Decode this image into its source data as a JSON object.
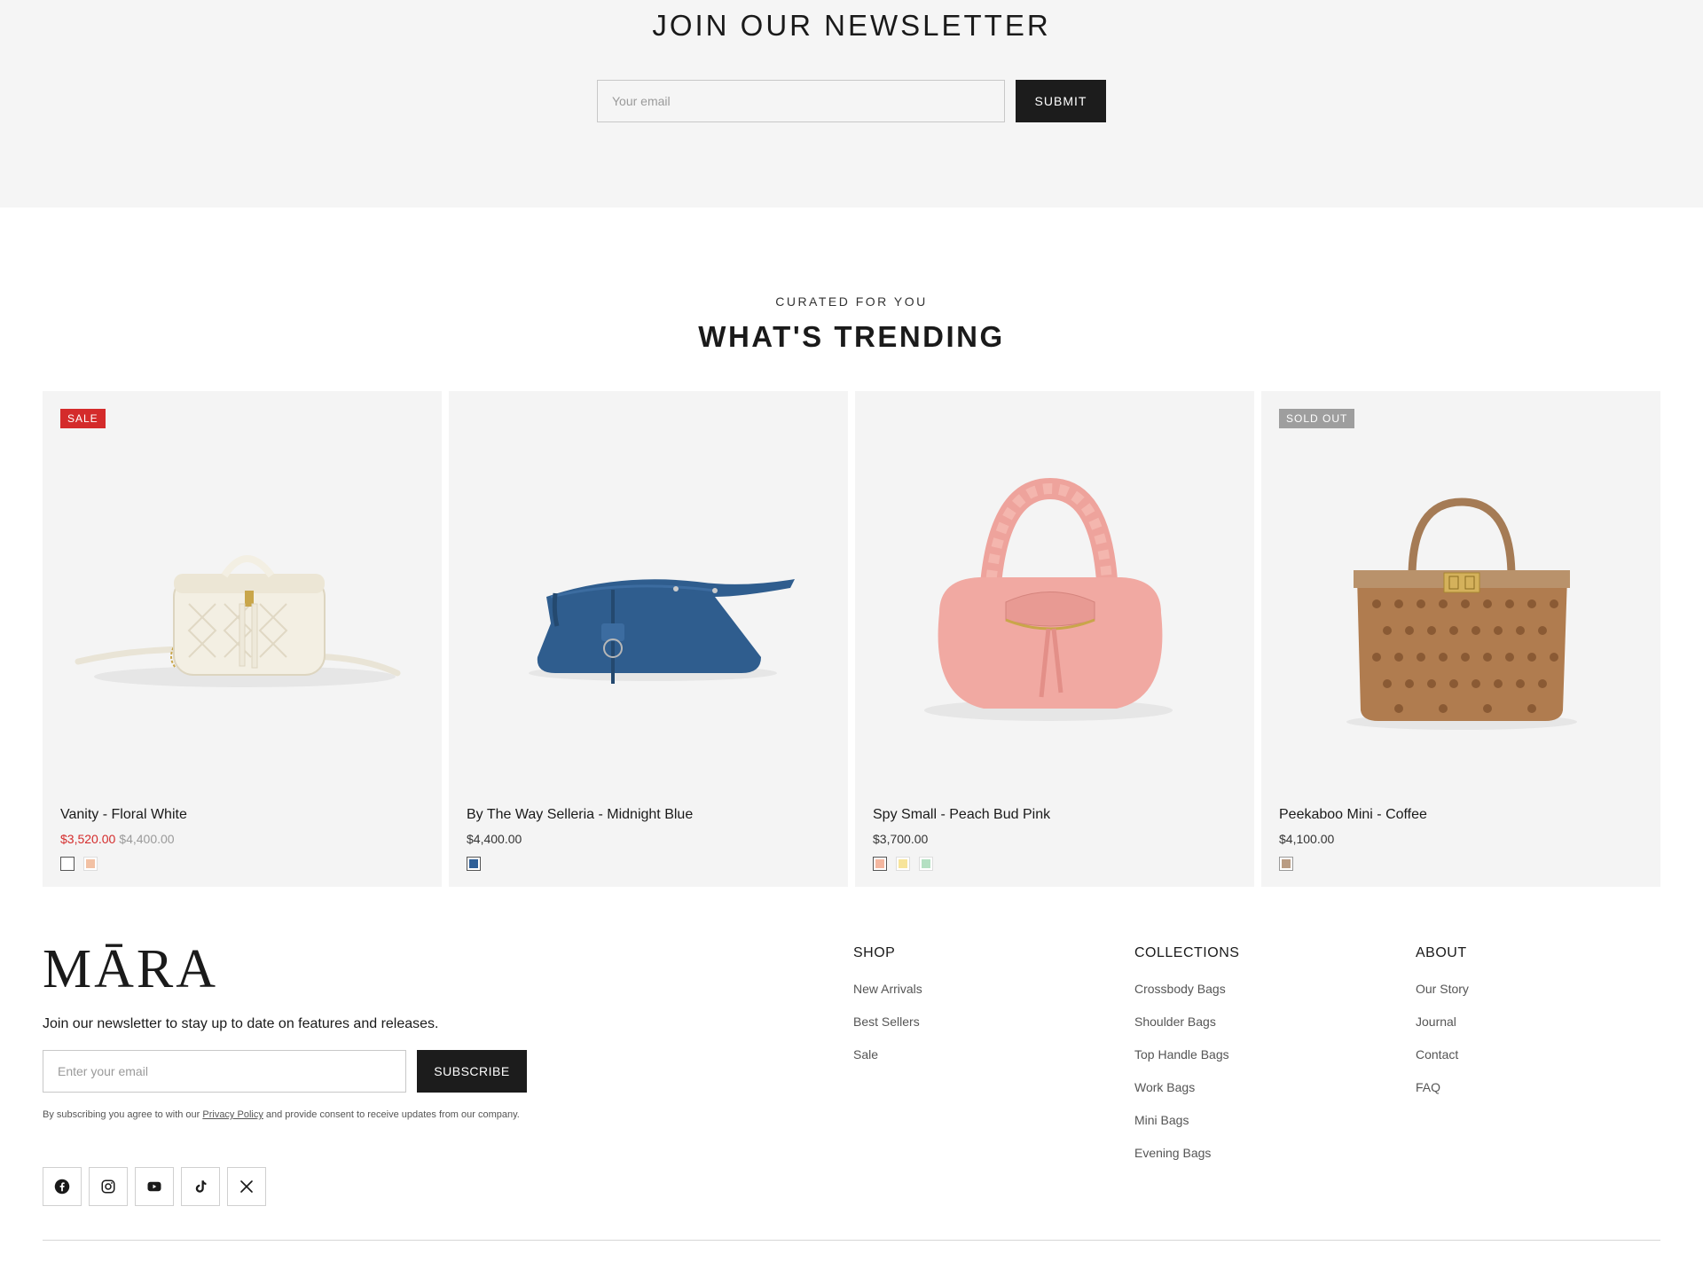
{
  "newsletter": {
    "title": "JOIN OUR NEWSLETTER",
    "placeholder": "Your email",
    "submit_label": "SUBMIT"
  },
  "trending": {
    "eyebrow": "CURATED FOR YOU",
    "title": "WHAT'S TRENDING",
    "products": [
      {
        "badge": "SALE",
        "name": "Vanity - Floral White",
        "sale_price": "$3,520.00",
        "original_price": "$4,400.00",
        "swatches": [
          "#ffffff",
          "#f2c1a4"
        ]
      },
      {
        "badge": "",
        "name": "By The Way Selleria - Midnight Blue",
        "price": "$4,400.00",
        "swatches": [
          "#2e5f97"
        ]
      },
      {
        "badge": "",
        "name": "Spy Small - Peach Bud Pink",
        "price": "$3,700.00",
        "swatches": [
          "#f4b7a0",
          "#f7e49a",
          "#b4e0c2"
        ]
      },
      {
        "badge": "SOLD OUT",
        "name": "Peekaboo Mini - Coffee",
        "price": "$4,100.00",
        "swatches": [
          "#b99c83"
        ]
      }
    ]
  },
  "footer": {
    "logo": "MĀRA",
    "copy": "Join our newsletter to stay up to date on features and releases.",
    "placeholder": "Enter your email",
    "subscribe_label": "SUBSCRIBE",
    "terms_before": "By subscribing you agree to with our ",
    "terms_link": "Privacy Policy",
    "terms_after": " and provide consent to receive updates from our company.",
    "socials": [
      "facebook-icon",
      "instagram-icon",
      "youtube-icon",
      "tiktok-icon",
      "x-icon"
    ],
    "columns": [
      {
        "title": "SHOP",
        "links": [
          "New Arrivals",
          "Best Sellers",
          "Sale"
        ]
      },
      {
        "title": "COLLECTIONS",
        "links": [
          "Crossbody Bags",
          "Shoulder Bags",
          "Top Handle Bags",
          "Work Bags",
          "Mini Bags",
          "Evening Bags"
        ]
      },
      {
        "title": "ABOUT",
        "links": [
          "Our Story",
          "Journal",
          "Contact",
          "FAQ"
        ]
      }
    ]
  },
  "colors": {
    "sale_red": "#d42b2b",
    "dark_button": "#1c1c1c",
    "band_bg": "#f5f5f5",
    "card_bg": "#f4f4f4"
  }
}
